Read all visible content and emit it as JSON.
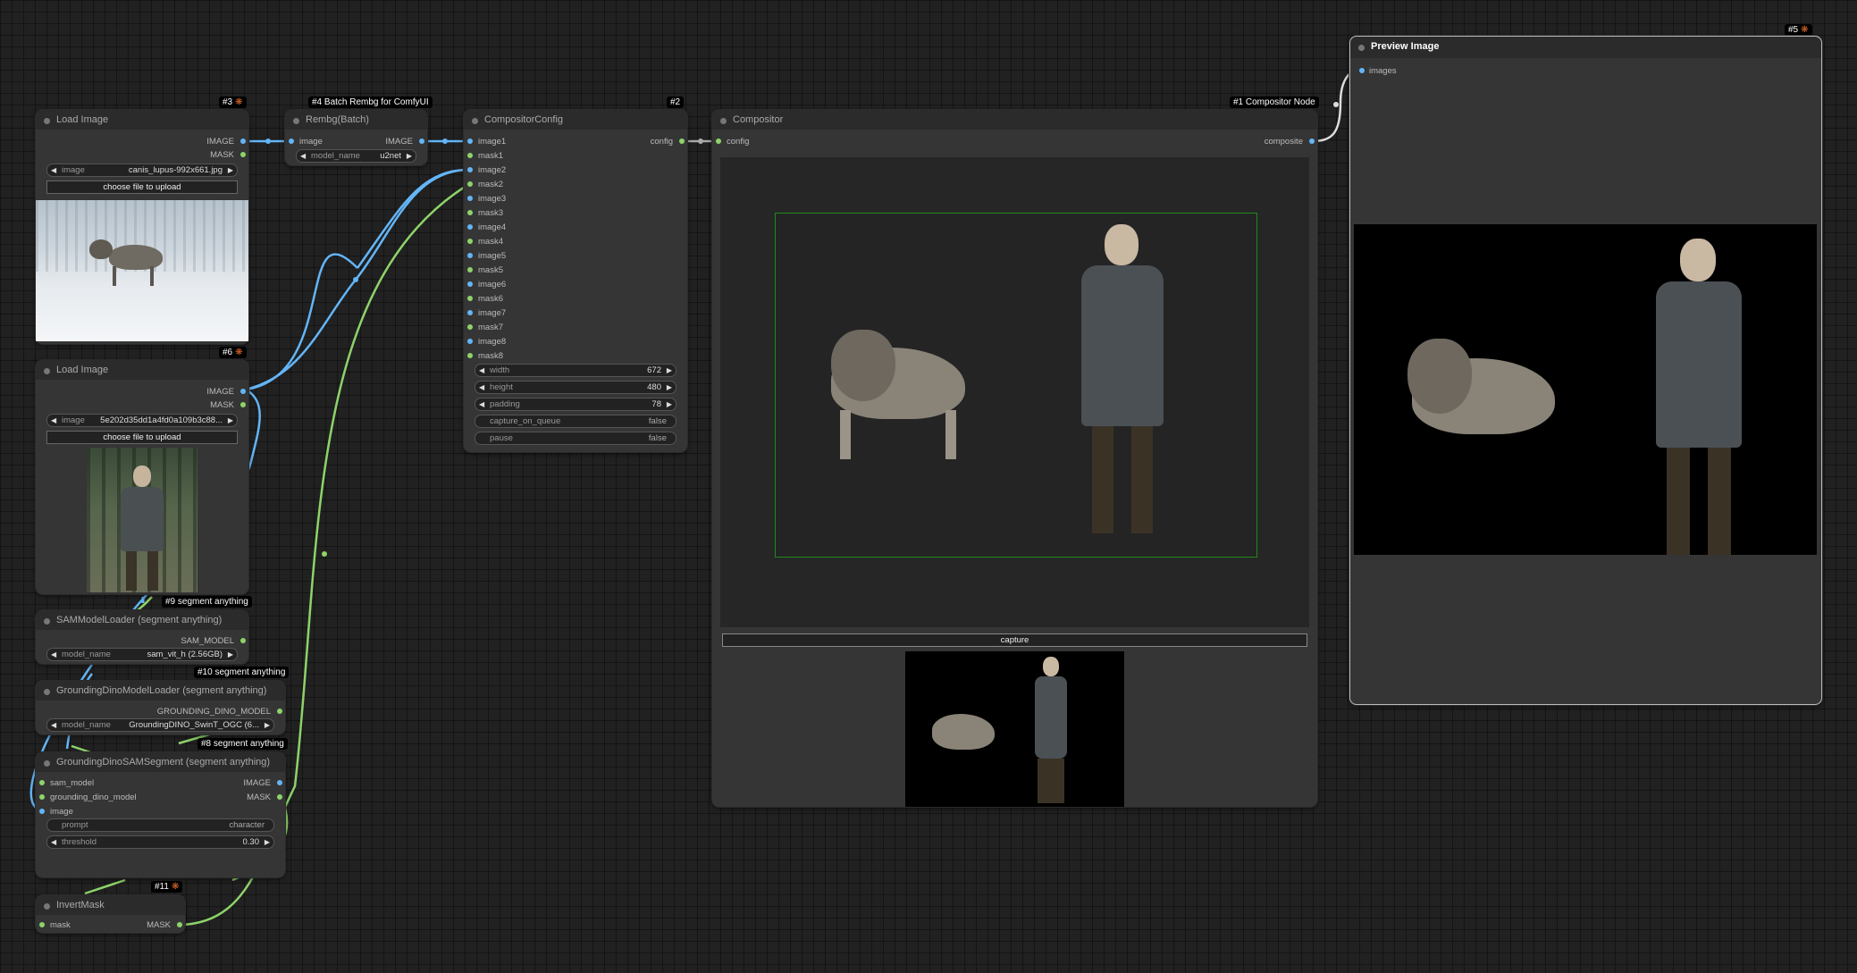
{
  "colors": {
    "canvas": "#212121",
    "node_bg": "#353535",
    "title_bg": "#2b2b2b",
    "wire_image": "#64b5f6",
    "wire_mask": "#8ed36a",
    "wire_config": "#aaaaaa"
  },
  "nodes": {
    "load_image_1": {
      "badge": "#3",
      "title": "Load Image",
      "outputs": [
        "IMAGE",
        "MASK"
      ],
      "image_label": "image",
      "image_value": "canis_lupus-992x661.jpg",
      "upload_label": "choose file to upload"
    },
    "load_image_2": {
      "badge": "#6",
      "title": "Load Image",
      "outputs": [
        "IMAGE",
        "MASK"
      ],
      "image_label": "image",
      "image_value": "5e202d35dd1a4fd0a109b3c88...",
      "upload_label": "choose file to upload"
    },
    "rembg": {
      "badge": "#4 Batch Rembg for ComfyUI",
      "title": "Rembg(Batch)",
      "input": "image",
      "output": "IMAGE",
      "model_label": "model_name",
      "model_value": "u2net"
    },
    "compositor_config": {
      "badge": "#2",
      "title": "CompositorConfig",
      "output": "config",
      "inputs": [
        "image1",
        "mask1",
        "image2",
        "mask2",
        "image3",
        "mask3",
        "image4",
        "mask4",
        "image5",
        "mask5",
        "image6",
        "mask6",
        "image7",
        "mask7",
        "image8",
        "mask8"
      ],
      "width_label": "width",
      "width_value": "672",
      "height_label": "height",
      "height_value": "480",
      "padding_label": "padding",
      "padding_value": "78",
      "capture_label": "capture_on_queue",
      "capture_value": "false",
      "pause_label": "pause",
      "pause_value": "false"
    },
    "compositor": {
      "badge": "#1 Compositor Node",
      "title": "Compositor",
      "input": "config",
      "output": "composite",
      "capture_button": "capture"
    },
    "preview": {
      "badge": "#5",
      "title": "Preview Image",
      "input": "images"
    },
    "sam_loader": {
      "badge": "#9 segment anything",
      "title": "SAMModelLoader (segment anything)",
      "output": "SAM_MODEL",
      "model_label": "model_name",
      "model_value": "sam_vit_h (2.56GB)"
    },
    "dino_loader": {
      "badge": "#10 segment anything",
      "title": "GroundingDinoModelLoader (segment anything)",
      "output": "GROUNDING_DINO_MODEL",
      "model_label": "model_name",
      "model_value": "GroundingDINO_SwinT_OGC (6..."
    },
    "dino_sam": {
      "badge": "#8 segment anything",
      "title": "GroundingDinoSAMSegment (segment anything)",
      "inputs": [
        "sam_model",
        "grounding_dino_model",
        "image"
      ],
      "outputs": [
        "IMAGE",
        "MASK"
      ],
      "prompt_label": "prompt",
      "prompt_value": "character",
      "threshold_label": "threshold",
      "threshold_value": "0.30"
    },
    "invert_mask": {
      "badge": "#11",
      "title": "InvertMask",
      "input": "mask",
      "output": "MASK"
    }
  }
}
